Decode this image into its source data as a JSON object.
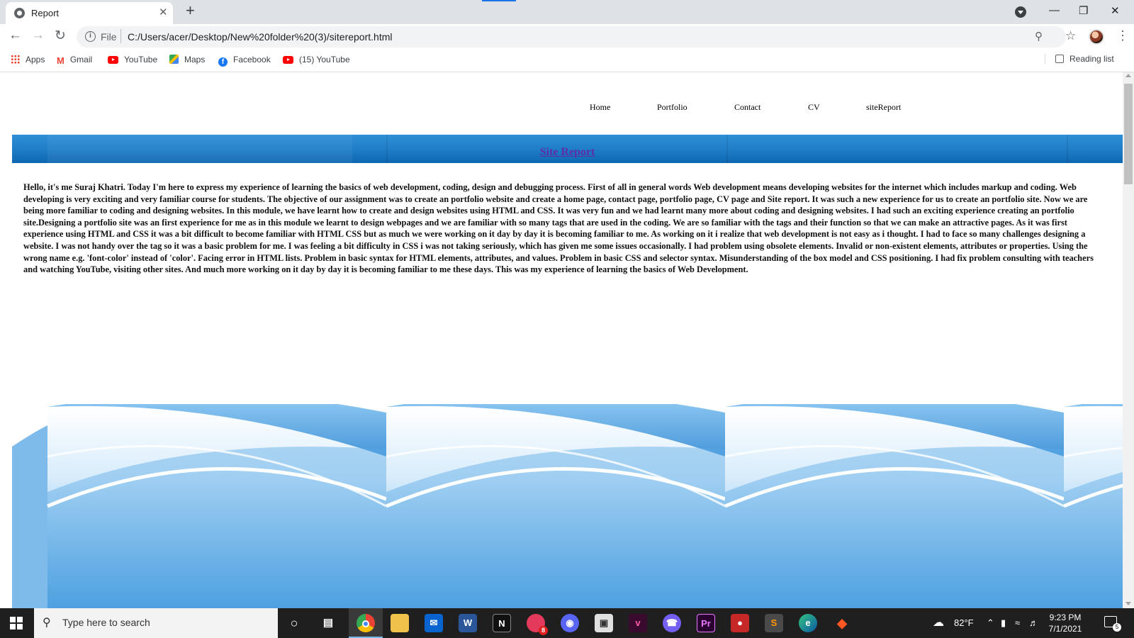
{
  "browser": {
    "tab_title": "Report",
    "new_tab_label": "+",
    "close_label": "✕",
    "url_scheme": "File",
    "url": "C:/Users/acer/Desktop/New%20folder%20(3)/sitereport.html",
    "bookmarks": [
      "Apps",
      "Gmail",
      "YouTube",
      "Maps",
      "Facebook",
      "(15) YouTube"
    ],
    "reading_list": "Reading list"
  },
  "site": {
    "nav": [
      "Home",
      "Portfolio",
      "Contact",
      "CV",
      "siteReport"
    ],
    "heading": "Site Report",
    "body": "Hello, it's me Suraj Khatri. Today I'm here to express my experience of learning the basics of web development, coding, design and debugging process. First of all in general words Web development means developing websites for the internet which includes markup and coding. Web developing is very exciting and very familiar course for students. The objective of our assignment was to create an portfolio website and create a home page, contact page, portfolio page, CV page and Site report. It was such a new experience for us to create an portfolio site. Now we are being more familiar to coding and designing websites. In this module, we have learnt how to create and design websites using HTML and CSS. It was very fun and we had learnt many more about coding and designing websites. I had such an exciting experience creating an portfolio site.Designing a portfolio site was an first experience for me as in this module we learnt to design webpages and we are familiar with so many tags that are used in the coding. We are so familiar with the tags and their function so that we can make an attractive pages. As it was first experience using HTML and CSS it was a bit difficult to become familiar with HTML CSS but as much we were working on it day by day it is becoming familiar to me. As working on it i realize that web development is not easy as i thought. I had to face so many challenges designing a website. I was not handy over the tag so it was a basic problem for me. I was feeling a bit difficulty in CSS i was not taking seriously, which has given me some issues occasionally. I had problem using obsolete elements. Invalid or non-existent elements, attributes or properties. Using the wrong name e.g. 'font-color' instead of 'color'. Facing error in HTML lists. Problem in basic syntax for HTML elements, attributes, and values. Problem in basic CSS and selector syntax. Misunderstanding of the box model and CSS positioning. I had fix problem consulting with teachers and watching YouTube, visiting other sites. And much more working on it day by day it is becoming familiar to me these days. This was my experience of learning the basics of Web Development."
  },
  "taskbar": {
    "search_placeholder": "Type here to search",
    "temperature": "82°F",
    "time": "9:23 PM",
    "date": "7/1/2021",
    "notification_count": "5",
    "viber_badge": "8"
  },
  "colors": {
    "banner_blue": "#1e7cc6",
    "heading_purple": "#5b2fa6"
  }
}
